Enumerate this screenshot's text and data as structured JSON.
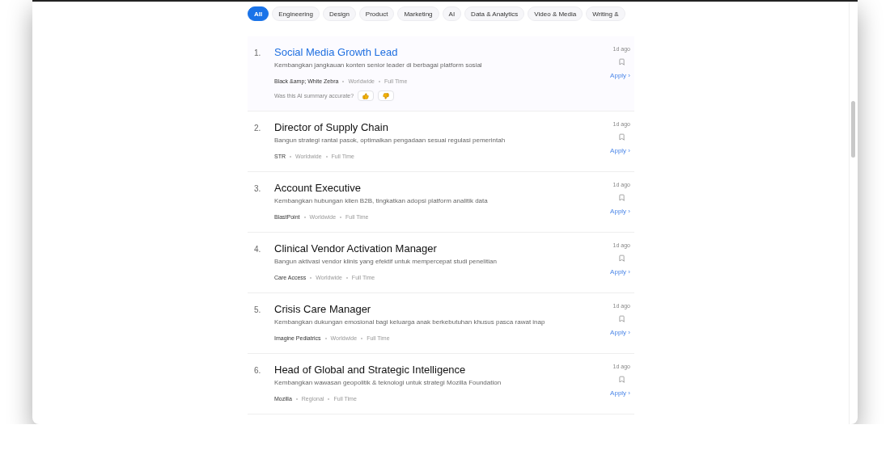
{
  "categories": [
    {
      "label": "All",
      "selected": true
    },
    {
      "label": "Engineering",
      "selected": false
    },
    {
      "label": "Design",
      "selected": false
    },
    {
      "label": "Product",
      "selected": false
    },
    {
      "label": "Marketing",
      "selected": false
    },
    {
      "label": "AI",
      "selected": false
    },
    {
      "label": "Data & Analytics",
      "selected": false
    },
    {
      "label": "Video & Media",
      "selected": false
    },
    {
      "label": "Writing &",
      "selected": false
    }
  ],
  "jobs": [
    {
      "number": "1.",
      "title": "Social Media Growth Lead",
      "summary": "Kembangkan jangkauan konten senior leader di berbagai platform sosial",
      "company": "Black &amp; White Zebra",
      "location": "Worldwide",
      "type": "Full Time",
      "posted": "1d ago",
      "apply": "Apply ›",
      "selected": true,
      "feedback_prompt": "Was this AI summary accurate?"
    },
    {
      "number": "2.",
      "title": "Director of Supply Chain",
      "summary": "Bangun strategi rantai pasok, optimalkan pengadaan sesuai regulasi pemerintah",
      "company": "STR",
      "location": "Worldwide",
      "type": "Full Time",
      "posted": "1d ago",
      "apply": "Apply ›",
      "selected": false
    },
    {
      "number": "3.",
      "title": "Account Executive",
      "summary": "Kembangkan hubungan klien B2B, tingkatkan adopsi platform analitik data",
      "company": "BlastPoint",
      "location": "Worldwide",
      "type": "Full Time",
      "posted": "1d ago",
      "apply": "Apply ›",
      "selected": false
    },
    {
      "number": "4.",
      "title": "Clinical Vendor Activation Manager",
      "summary": "Bangun aktivasi vendor klinis yang efektif untuk mempercepat studi penelitian",
      "company": "Care Access",
      "location": "Worldwide",
      "type": "Full Time",
      "posted": "1d ago",
      "apply": "Apply ›",
      "selected": false
    },
    {
      "number": "5.",
      "title": "Crisis Care Manager",
      "summary": "Kembangkan dukungan emosional bagi keluarga anak berkebutuhan khusus pasca rawat inap",
      "company": "Imagine Pediatrics",
      "location": "Worldwide",
      "type": "Full Time",
      "posted": "1d ago",
      "apply": "Apply ›",
      "selected": false
    },
    {
      "number": "6.",
      "title": "Head of Global and Strategic Intelligence",
      "summary": "Kembangkan wawasan geopolitik & teknologi untuk strategi Mozilla Foundation",
      "company": "Mozilla",
      "location": "Regional",
      "type": "Full Time",
      "posted": "1d ago",
      "apply": "Apply ›",
      "selected": false
    }
  ]
}
